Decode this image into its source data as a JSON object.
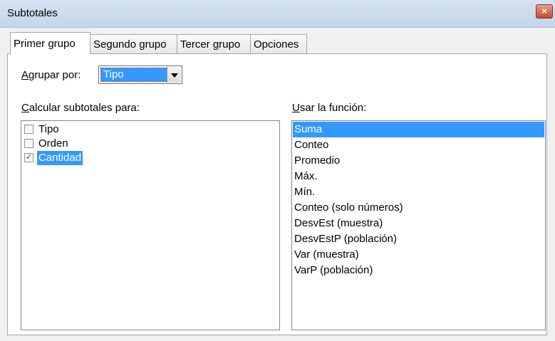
{
  "window": {
    "title": "Subtotales",
    "close_glyph": "×",
    "close_icon": "close-icon"
  },
  "tabs": [
    {
      "label": "Primer grupo",
      "active": true
    },
    {
      "label": "Segundo grupo",
      "active": false
    },
    {
      "label": "Tercer grupo",
      "active": false
    },
    {
      "label": "Opciones",
      "active": false
    }
  ],
  "group_by": {
    "label_accel": "A",
    "label_rest": "grupar por:",
    "selected": "Tipo"
  },
  "calc_for": {
    "label_accel": "C",
    "label_rest": "alcular subtotales para:",
    "items": [
      {
        "label": "Tipo",
        "checked": false,
        "selected": false
      },
      {
        "label": "Orden",
        "checked": false,
        "selected": false
      },
      {
        "label": "Cantidad",
        "checked": true,
        "selected": true
      }
    ]
  },
  "use_function": {
    "label_accel": "U",
    "label_rest": "sar la función:",
    "items": [
      {
        "label": "Suma",
        "selected": true
      },
      {
        "label": "Conteo",
        "selected": false
      },
      {
        "label": "Promedio",
        "selected": false
      },
      {
        "label": "Máx.",
        "selected": false
      },
      {
        "label": "Mín.",
        "selected": false
      },
      {
        "label": "Conteo (solo números)",
        "selected": false
      },
      {
        "label": "DesvEst (muestra)",
        "selected": false
      },
      {
        "label": "DesvEstP (población)",
        "selected": false
      },
      {
        "label": "Var (muestra)",
        "selected": false
      },
      {
        "label": "VarP (población)",
        "selected": false
      }
    ]
  },
  "colors": {
    "selection": "#3399ff",
    "titlebar": "#c9daf0",
    "close": "#c4492f"
  }
}
